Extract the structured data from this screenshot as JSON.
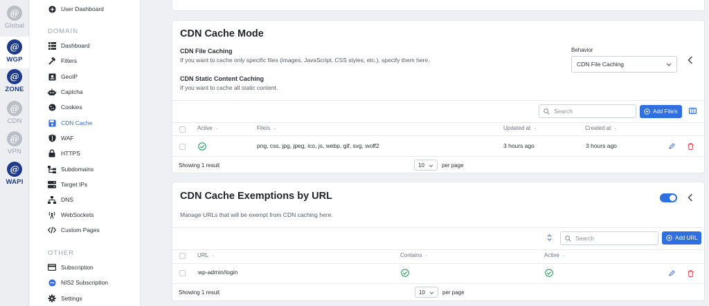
{
  "rail": {
    "items": [
      {
        "label": "Global",
        "style": "muted",
        "active": false
      },
      {
        "label": "WGP",
        "style": "brand",
        "active": true
      },
      {
        "label": "ZONE",
        "style": "brand",
        "active": false
      },
      {
        "label": "CDN",
        "style": "muted",
        "active": false
      },
      {
        "label": "VPN",
        "style": "muted",
        "active": false
      },
      {
        "label": "WAPI",
        "style": "brand",
        "active": false
      }
    ]
  },
  "sidebar": {
    "top_item": {
      "label": "User Dashboard",
      "icon": "plus-circle-icon"
    },
    "section_domain": "DOMAIN",
    "domain_items": [
      {
        "label": "Dashboard",
        "icon": "grid-icon"
      },
      {
        "label": "Filters",
        "icon": "hammer-icon"
      },
      {
        "label": "GeoIP",
        "icon": "geoip-icon"
      },
      {
        "label": "Captcha",
        "icon": "robot-icon"
      },
      {
        "label": "Cookies",
        "icon": "cookie-icon"
      },
      {
        "label": "CDN Cache",
        "icon": "floppy-icon",
        "active": true
      },
      {
        "label": "WAF",
        "icon": "shield-icon"
      },
      {
        "label": "HTTPS",
        "icon": "lock-icon"
      },
      {
        "label": "Subdomains",
        "icon": "sitemap-icon"
      },
      {
        "label": "Target IPs",
        "icon": "server-icon"
      },
      {
        "label": "DNS",
        "icon": "network-icon"
      },
      {
        "label": "WebSockets",
        "icon": "broadcast-icon"
      },
      {
        "label": "Custom Pages",
        "icon": "code-icon"
      }
    ],
    "section_other": "OTHER",
    "other_items": [
      {
        "label": "Subscription",
        "icon": "card-icon"
      },
      {
        "label": "NIS2 Subscription",
        "icon": "minus-circle-icon"
      },
      {
        "label": "Settings",
        "icon": "gear-icon"
      }
    ]
  },
  "cdn_cache_mode": {
    "title": "CDN Cache Mode",
    "file_caching_title": "CDN File Caching",
    "file_caching_desc": "If you want to cache only specific files (images, JavaScript, CSS styles, etc.), specify them here.",
    "static_title": "CDN Static Content Caching",
    "static_desc": "If you want to cache all static content.",
    "behavior_label": "Behavior",
    "behavior_value": "CDN File Caching",
    "search_placeholder": "Search",
    "add_button": "Add File/s",
    "columns": [
      "Active",
      "File/s",
      "Updated at",
      "Created at"
    ],
    "rows": [
      {
        "active": true,
        "files": "png, css, jpg, jpeg, ico, js, webp, gif, svg, woff2",
        "updated": "3 hours ago",
        "created": "3 hours ago"
      }
    ],
    "showing": "Showing 1 result",
    "per_page_value": "10",
    "per_page_label": "per page"
  },
  "exemptions": {
    "title": "CDN Cache Exemptions by URL",
    "desc": "Manage URLs that will be exempt from CDN caching here.",
    "toggle_on": true,
    "search_placeholder": "Search",
    "add_button": "Add URL",
    "columns": [
      "URL",
      "Contains",
      "Active"
    ],
    "rows": [
      {
        "url": "wp-admin/login",
        "contains": true,
        "active": true
      }
    ],
    "showing": "Showing 1 result",
    "per_page_value": "10",
    "per_page_label": "per page"
  },
  "colors": {
    "primary": "#2f6fe0",
    "brand": "#1e3a8a",
    "success": "#22a55a",
    "danger": "#e5484d"
  }
}
